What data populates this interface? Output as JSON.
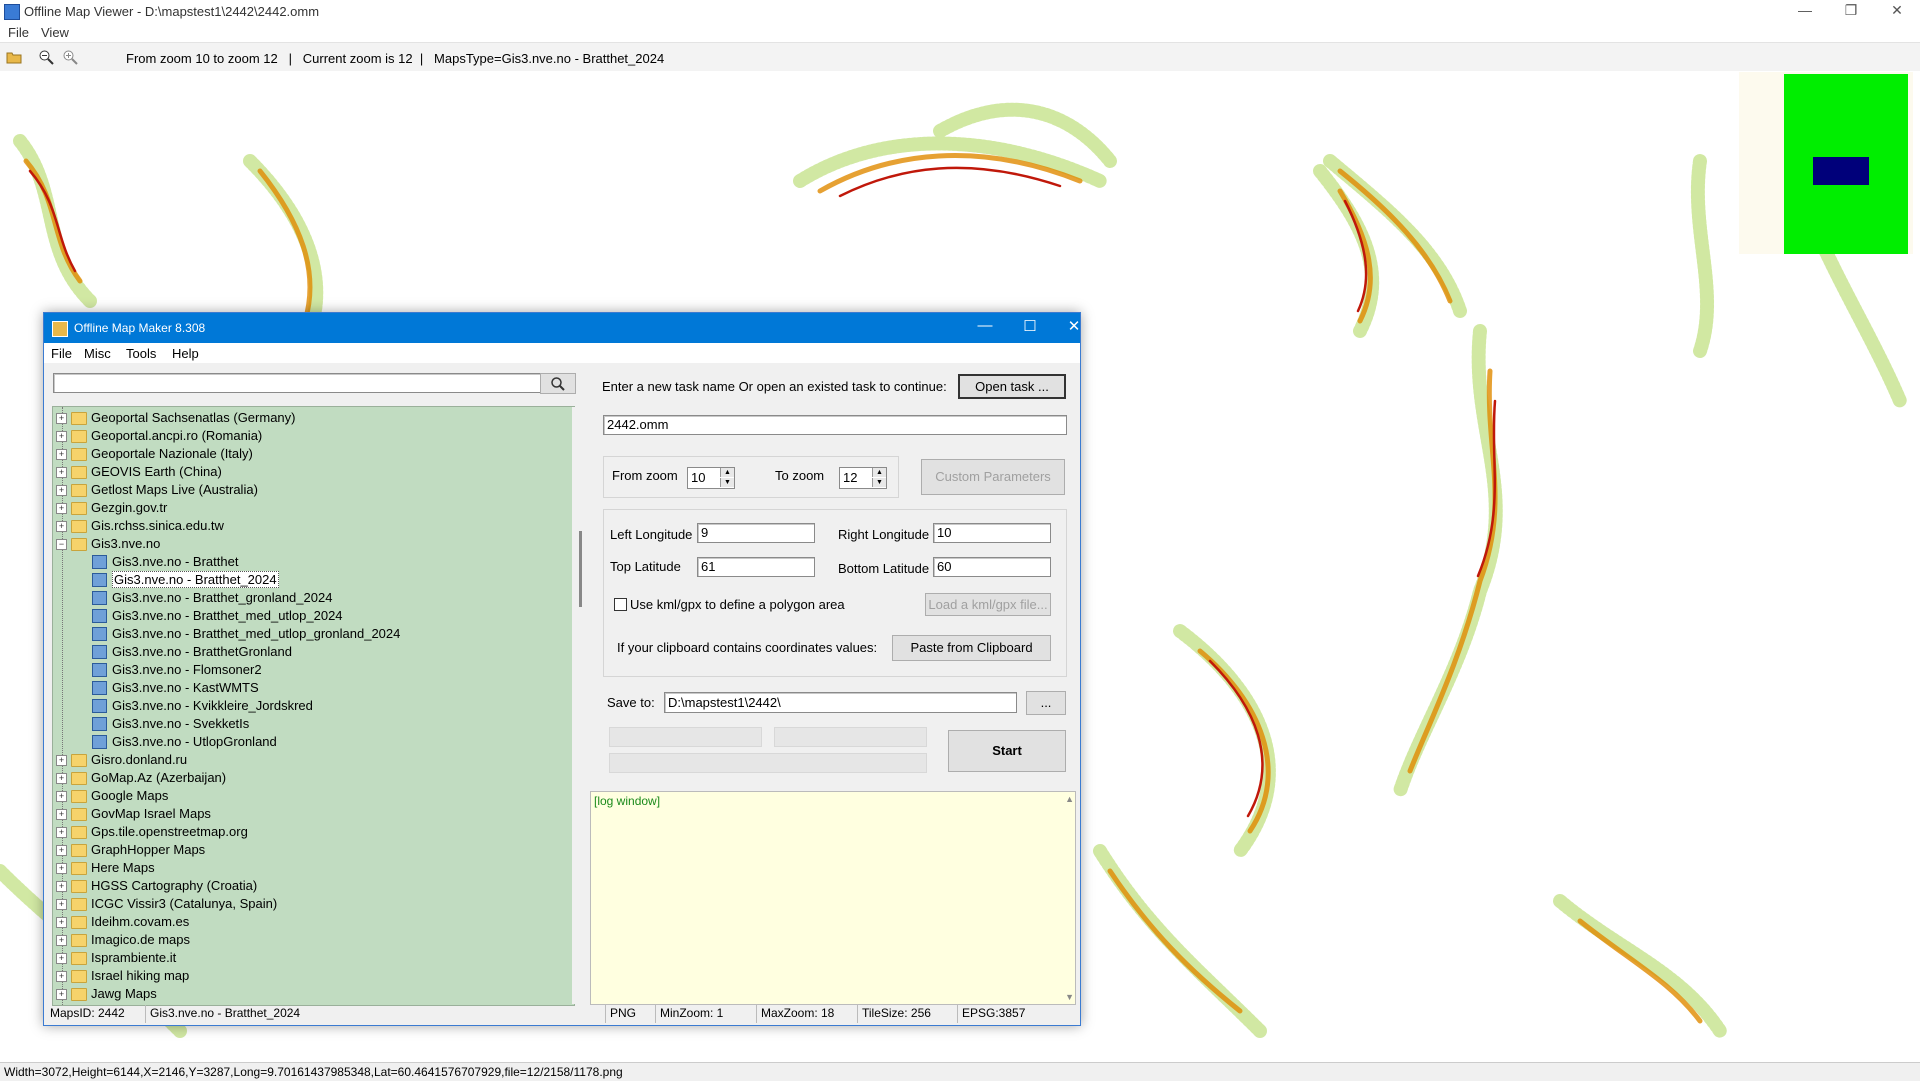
{
  "viewer": {
    "title": "Offline Map Viewer - D:\\mapstest1\\2442\\2442.omm",
    "menu": [
      "File",
      "View"
    ],
    "toolbar_status": "From zoom 10 to zoom 12   |   Current zoom is 12  |   MapsType=Gis3.nve.no - Bratthet_2024",
    "bottom_status": "Width=3072,Height=6144,X=2146,Y=3287,Long=9.70161437985348,Lat=60.4641576707929,file=12/2158/1178.png",
    "window_controls": [
      "—",
      "❐",
      "✕"
    ]
  },
  "dialog": {
    "title": "Offline Map Maker 8.308",
    "menu": [
      "File",
      "Misc",
      "Tools",
      "Help"
    ],
    "controls": [
      "—",
      "☐",
      "✕"
    ],
    "search": {
      "value": "",
      "placeholder": ""
    },
    "tree": [
      {
        "label": "Geoportal Sachsenatlas (Germany)",
        "level": 0,
        "kind": "folder",
        "expanded": false
      },
      {
        "label": "Geoportal.ancpi.ro (Romania)",
        "level": 0,
        "kind": "folder",
        "expanded": false
      },
      {
        "label": "Geoportale Nazionale (Italy)",
        "level": 0,
        "kind": "folder",
        "expanded": false
      },
      {
        "label": "GEOVIS Earth (China)",
        "level": 0,
        "kind": "folder",
        "expanded": false
      },
      {
        "label": "Getlost Maps Live (Australia)",
        "level": 0,
        "kind": "folder",
        "expanded": false
      },
      {
        "label": "Gezgin.gov.tr",
        "level": 0,
        "kind": "folder",
        "expanded": false
      },
      {
        "label": "Gis.rchss.sinica.edu.tw",
        "level": 0,
        "kind": "folder",
        "expanded": false
      },
      {
        "label": "Gis3.nve.no",
        "level": 0,
        "kind": "folder",
        "expanded": true
      },
      {
        "label": "Gis3.nve.no - Bratthet",
        "level": 1,
        "kind": "map"
      },
      {
        "label": "Gis3.nve.no - Bratthet_2024",
        "level": 1,
        "kind": "map",
        "selected": true
      },
      {
        "label": "Gis3.nve.no - Bratthet_gronland_2024",
        "level": 1,
        "kind": "map"
      },
      {
        "label": "Gis3.nve.no - Bratthet_med_utlop_2024",
        "level": 1,
        "kind": "map"
      },
      {
        "label": "Gis3.nve.no - Bratthet_med_utlop_gronland_2024",
        "level": 1,
        "kind": "map"
      },
      {
        "label": "Gis3.nve.no - BratthetGronland",
        "level": 1,
        "kind": "map"
      },
      {
        "label": "Gis3.nve.no - Flomsoner2",
        "level": 1,
        "kind": "map"
      },
      {
        "label": "Gis3.nve.no - KastWMTS",
        "level": 1,
        "kind": "map"
      },
      {
        "label": "Gis3.nve.no - Kvikkleire_Jordskred",
        "level": 1,
        "kind": "map"
      },
      {
        "label": "Gis3.nve.no - SvekketIs",
        "level": 1,
        "kind": "map"
      },
      {
        "label": "Gis3.nve.no - UtlopGronland",
        "level": 1,
        "kind": "map"
      },
      {
        "label": "Gisro.donland.ru",
        "level": 0,
        "kind": "folder",
        "expanded": false
      },
      {
        "label": "GoMap.Az (Azerbaijan)",
        "level": 0,
        "kind": "folder",
        "expanded": false
      },
      {
        "label": "Google Maps",
        "level": 0,
        "kind": "folder",
        "expanded": false
      },
      {
        "label": "GovMap Israel Maps",
        "level": 0,
        "kind": "folder",
        "expanded": false
      },
      {
        "label": "Gps.tile.openstreetmap.org",
        "level": 0,
        "kind": "folder",
        "expanded": false
      },
      {
        "label": "GraphHopper Maps",
        "level": 0,
        "kind": "folder",
        "expanded": false
      },
      {
        "label": "Here Maps",
        "level": 0,
        "kind": "folder",
        "expanded": false
      },
      {
        "label": "HGSS Cartography (Croatia)",
        "level": 0,
        "kind": "folder",
        "expanded": false
      },
      {
        "label": "ICGC Vissir3 (Catalunya, Spain)",
        "level": 0,
        "kind": "folder",
        "expanded": false
      },
      {
        "label": "Ideihm.covam.es",
        "level": 0,
        "kind": "folder",
        "expanded": false
      },
      {
        "label": "Imagico.de maps",
        "level": 0,
        "kind": "folder",
        "expanded": false
      },
      {
        "label": "Isprambiente.it",
        "level": 0,
        "kind": "folder",
        "expanded": false
      },
      {
        "label": "Israel hiking map",
        "level": 0,
        "kind": "folder",
        "expanded": false
      },
      {
        "label": "Jawg Maps",
        "level": 0,
        "kind": "folder",
        "expanded": false
      }
    ],
    "task_prompt": "Enter a new task name Or open an existed task to continue:",
    "open_task": "Open task ...",
    "task_name": "2442.omm",
    "from_zoom_label": "From zoom",
    "from_zoom": "10",
    "to_zoom_label": "To zoom",
    "to_zoom": "12",
    "custom_params": "Custom Parameters",
    "left_lon_label": "Left Longitude",
    "left_lon": "9",
    "right_lon_label": "Right Longitude",
    "right_lon": "10",
    "top_lat_label": "Top Latitude",
    "top_lat": "61",
    "bottom_lat_label": "Bottom Latitude",
    "bottom_lat": "60",
    "kml_label": "Use kml/gpx to define a polygon area",
    "load_kml": "Load a kml/gpx file...",
    "clipboard_label": "If your clipboard contains coordinates values:",
    "paste_clipboard": "Paste from Clipboard",
    "save_to_label": "Save to:",
    "save_to": "D:\\mapstest1\\2442\\",
    "browse": "...",
    "start": "Start",
    "log": "[log window]",
    "status": {
      "maps_id": "MapsID: 2442",
      "map_name": "Gis3.nve.no - Bratthet_2024",
      "format": "PNG",
      "min_zoom": "MinZoom: 1",
      "max_zoom": "MaxZoom: 18",
      "tile_size": "TileSize: 256",
      "epsg": "EPSG:3857"
    }
  },
  "colors": {
    "dialog_title": "#0078d7",
    "tree_bg": "#c1dcc1",
    "log_bg": "#ffffe0",
    "minimap_green": "#00ee00",
    "minimap_navy": "#00007a"
  }
}
